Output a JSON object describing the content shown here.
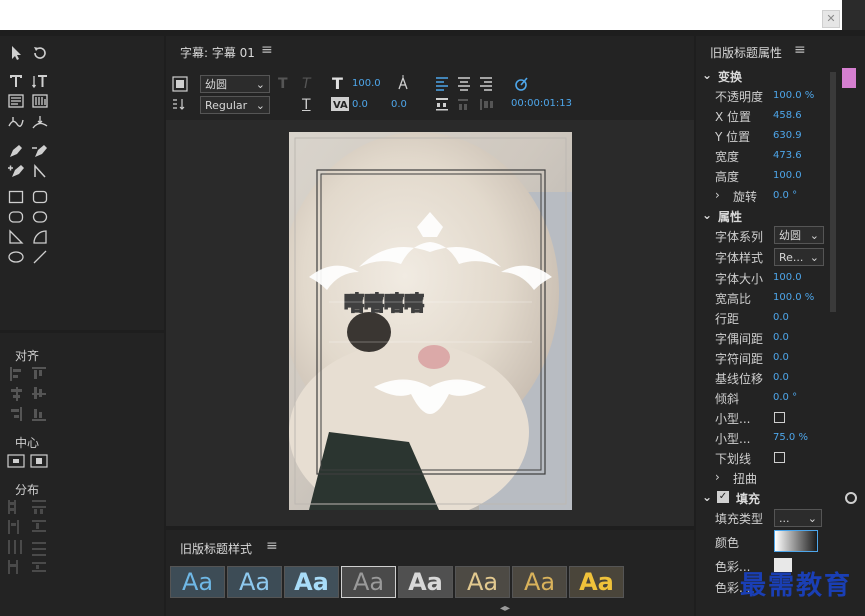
{
  "title_panel": {
    "title": "字幕: 字幕 01",
    "menu_glyph": "≡",
    "font_family": "幼圆",
    "font_style": "Regular",
    "font_size": "100.0",
    "kerning": "0.0",
    "tracking": "0.0",
    "timecode": "00:00:01:13",
    "canvas_text": "嘻嘻嘻嘻"
  },
  "left_panel": {
    "align_label": "对齐",
    "center_label": "中心",
    "distribute_label": "分布"
  },
  "props": {
    "title": "旧版标题属性",
    "menu_glyph": "≡",
    "transform": "变换",
    "opacity_label": "不透明度",
    "opacity_value": "100.0 %",
    "x_label": "X 位置",
    "x_value": "458.6",
    "y_label": "Y 位置",
    "y_value": "630.9",
    "width_label": "宽度",
    "width_value": "473.6",
    "height_label": "高度",
    "height_value": "100.0",
    "rotation_label": "旋转",
    "rotation_value": "0.0 °",
    "properties": "属性",
    "font_family_label": "字体系列",
    "font_family_value": "幼圆",
    "font_style_label": "字体样式",
    "font_style_value": "Re...",
    "font_size_label": "字体大小",
    "font_size_value": "100.0",
    "aspect_label": "宽高比",
    "aspect_value": "100.0 %",
    "leading_label": "行距",
    "leading_value": "0.0",
    "kerning_label": "字偶间距",
    "kerning_value": "0.0",
    "tracking_label": "字符间距",
    "tracking_value": "0.0",
    "baseline_label": "基线位移",
    "baseline_value": "0.0",
    "slant_label": "倾斜",
    "slant_value": "0.0 °",
    "smallcaps_label": "小型...",
    "smallcaps_size_label": "小型...",
    "smallcaps_size_value": "75.0 %",
    "underline_label": "下划线",
    "distort_label": "扭曲",
    "fill": "填充",
    "fill_type_label": "填充类型",
    "fill_type_value": "...",
    "color_label": "颜色",
    "color_stop_label": "色彩...",
    "color_stop2_label": "色彩..."
  },
  "styles_panel": {
    "title": "旧版标题样式",
    "menu_glyph": "≡",
    "sample": "Aa"
  },
  "watermark": "最需教育",
  "close_glyph": "✕"
}
